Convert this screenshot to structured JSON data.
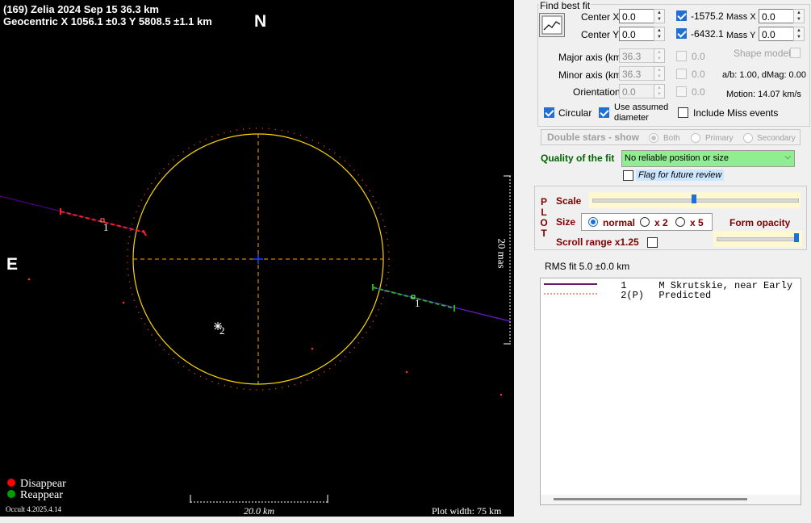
{
  "plot": {
    "title": "(169) Zelia  2024 Sep 15   36.3 km",
    "geocentric": "Geocentric  X  1056.1 ±0.3  Y 5808.5 ±1.1 km",
    "north": "N",
    "east": "E",
    "scale_mas": "20 mas",
    "scale_km": "20.0 km",
    "plot_width": "Plot width: 75 km",
    "version": "Occult 4.2025.4.14",
    "legend": [
      {
        "label": "Disappear",
        "color": "#ff0000"
      },
      {
        "label": "Reappear",
        "color": "#00a000"
      }
    ],
    "chord_labels": [
      "1",
      "1",
      "2"
    ],
    "colors": {
      "ellipse": "#ffd700",
      "axes": "#ffa500",
      "chord": "#4b0082",
      "disappear": "#ff2020",
      "reappear": "#20a020"
    }
  },
  "fit": {
    "group_title": "Find best fit",
    "fit_icon": "chart-fit-icon",
    "center_x_label": "Center X",
    "center_x_value": "0.0",
    "center_y_label": "Center Y",
    "center_y_value": "0.0",
    "mass_x_check": "-1575.2",
    "mass_x_label": "Mass X",
    "mass_x_value": "0.0",
    "mass_y_check": "-6432.1",
    "mass_y_label": "Mass Y",
    "mass_y_value": "0.0",
    "major_label": "Major axis (km)",
    "major_value": "36.3",
    "major_check": "0.0",
    "minor_label": "Minor axis (km)",
    "minor_value": "36.3",
    "minor_check": "0.0",
    "orient_label": "Orientation",
    "orient_value": "0.0",
    "orient_check": "0.0",
    "shape_model": "Shape model",
    "ab_ratio": "a/b: 1.00, dMag: 0.00",
    "motion": "Motion: 14.07 km/s",
    "circular": "Circular",
    "use_assumed_1": "Use assumed",
    "use_assumed_2": "diameter",
    "include_miss": "Include Miss events",
    "double_stars": "Double stars - show",
    "ds_both": "Both",
    "ds_primary": "Primary",
    "ds_secondary": "Secondary",
    "quality_label": "Quality of the fit",
    "quality_value": "No reliable position or size",
    "quality_color": "#90ee90",
    "flag_review": "Flag for future review"
  },
  "plotpanel": {
    "plot_letters": [
      "P",
      "L",
      "O",
      "T"
    ],
    "scale_label": "Scale",
    "size_label": "Size",
    "size_normal": "normal",
    "size_x2": "x 2",
    "size_x5": "x 5",
    "form_opacity": "Form opacity",
    "scroll_range": "Scroll range x1.25"
  },
  "rms": "RMS fit 5.0 ±0.0 km",
  "legend_list": [
    {
      "num": "1",
      "text": "M Skrutskie, near Early"
    },
    {
      "num": "2(P)",
      "text": "Predicted"
    }
  ]
}
